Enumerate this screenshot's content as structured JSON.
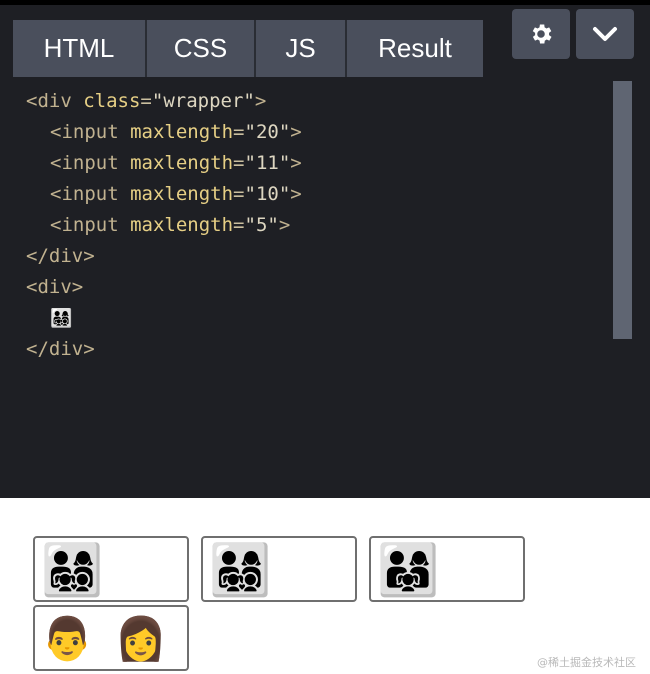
{
  "tabs": [
    "HTML",
    "CSS",
    "JS",
    "Result"
  ],
  "controls": {
    "settings_icon": "gear-icon",
    "collapse_icon": "chevron-down-icon"
  },
  "code": {
    "wrapper_open": {
      "tag_open": "<div",
      "attr": "class",
      "eq": "=",
      "value": "\"wrapper\"",
      "close": ">"
    },
    "inputs": [
      {
        "tag": "<input",
        "attr": "maxlength",
        "eq": "=",
        "value": "\"20\"",
        "close": ">"
      },
      {
        "tag": "<input",
        "attr": "maxlength",
        "eq": "=",
        "value": "\"11\"",
        "close": ">"
      },
      {
        "tag": "<input",
        "attr": "maxlength",
        "eq": "=",
        "value": "\"10\"",
        "close": ">"
      },
      {
        "tag": "<input",
        "attr": "maxlength",
        "eq": "=",
        "value": "\"5\"",
        "close": ">"
      }
    ],
    "wrapper_close": "</div>",
    "div_open": "<div>",
    "emoji": "👨‍👩‍👧‍👦",
    "div_close": "</div>"
  },
  "result": {
    "inputs": [
      {
        "value": "👨‍👩‍👧‍👦"
      },
      {
        "value": "👨‍👩‍👧‍👦"
      },
      {
        "value": "👨‍👩‍👧"
      },
      {
        "value": "👨 👩"
      }
    ]
  },
  "watermark": "@稀土掘金技术社区",
  "colors": {
    "editor_bg": "#1e1f24",
    "tab_bg": "#4a4f5c",
    "tag": "#c1b290",
    "attr": "#e6cf85"
  }
}
